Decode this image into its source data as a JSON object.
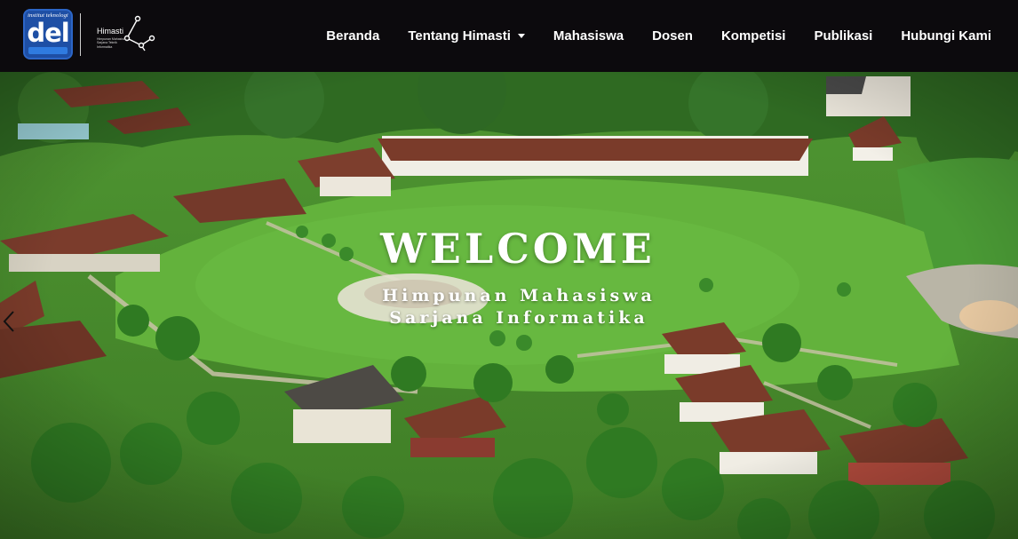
{
  "brand": {
    "del_top": "institut teknologi",
    "del_word": "del",
    "himasti_word": "Himasti",
    "himasti_sub": "Himpunan Mahasiswa Sarjana Teknik Informatika"
  },
  "nav": {
    "items": [
      {
        "label": "Beranda"
      },
      {
        "label": "Tentang Himasti",
        "dropdown": true
      },
      {
        "label": "Mahasiswa"
      },
      {
        "label": "Dosen"
      },
      {
        "label": "Kompetisi"
      },
      {
        "label": "Publikasi"
      },
      {
        "label": "Hubungi Kami"
      }
    ]
  },
  "hero": {
    "title": "WELCOME",
    "subtitle_line1": "Himpunan Mahasiswa",
    "subtitle_line2": "Sarjana Informatika",
    "prev_icon": "chevron-left-icon"
  },
  "colors": {
    "navbar": "#0c0a0d",
    "nav_text": "#ffffff",
    "logo_blue": "#1e4fa5",
    "grass": "#5fa83a",
    "roof": "#7a3b2a"
  }
}
